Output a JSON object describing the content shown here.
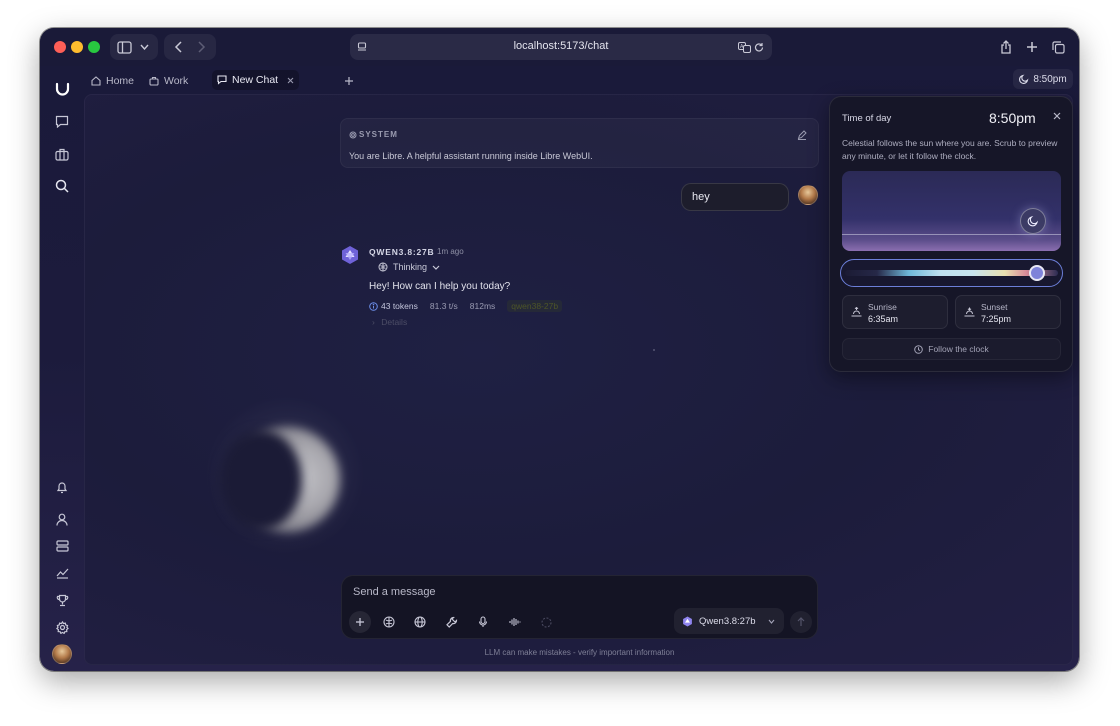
{
  "browser": {
    "url": "localhost:5173/chat"
  },
  "tabs": [
    {
      "label": "Home"
    },
    {
      "label": "Work"
    },
    {
      "label": "New Chat"
    }
  ],
  "header": {
    "clock_label": "8:50pm"
  },
  "chat": {
    "system": {
      "label": "SYSTEM",
      "text": "You are Libre. A helpful assistant running inside Libre WebUI."
    },
    "user_message": "hey",
    "assistant": {
      "name": "QWEN3.8:27B",
      "time": "1m ago",
      "thinking_label": "Thinking",
      "reply": "Hey! How can I help you today?",
      "tokens": "43 tokens",
      "speed": "81.3 t/s",
      "latency": "812ms",
      "model_tag": "qwen38-27b",
      "details_label": "Details"
    }
  },
  "composer": {
    "placeholder": "Send a message",
    "model_label": "Qwen3.8:27b"
  },
  "footer": {
    "note": "LLM can make mistakes - verify important information"
  },
  "time_panel": {
    "title": "Time of day",
    "time": "8:50pm",
    "description": "Celestial follows the sun where you are. Scrub to preview any minute, or let it follow the clock.",
    "slider_value": 0.9,
    "sunrise_label": "Sunrise",
    "sunrise_time": "6:35am",
    "sunset_label": "Sunset",
    "sunset_time": "7:25pm",
    "follow_label": "Follow the clock"
  },
  "colors": {
    "accent": "#6c7fd9",
    "background": "#1c1c3b"
  }
}
